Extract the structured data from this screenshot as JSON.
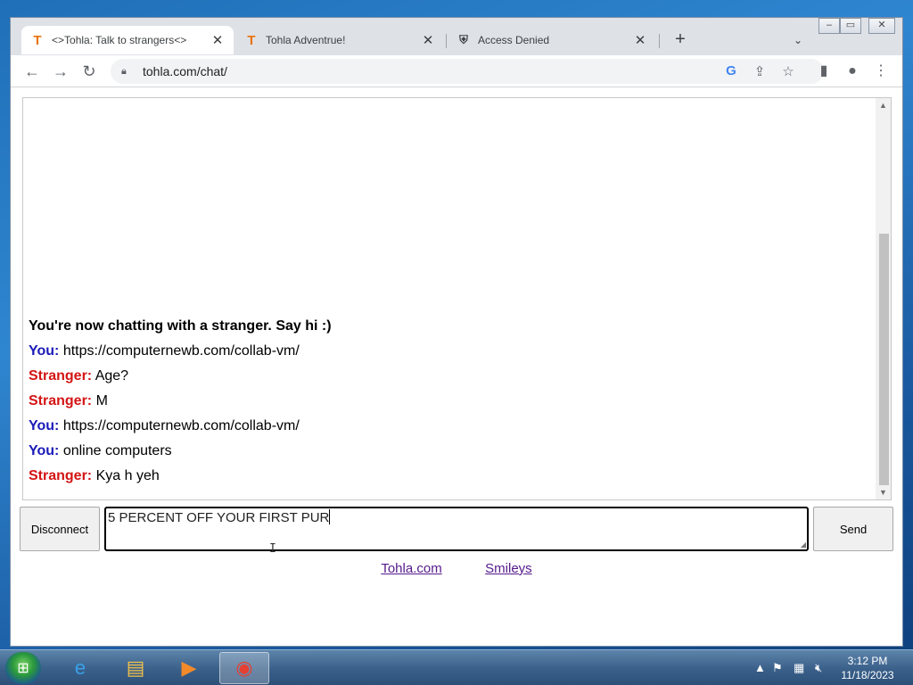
{
  "browser": {
    "tabs": [
      {
        "title": "<>Tohla: Talk to strangers<>",
        "favicon": "tohla-favicon",
        "active": true
      },
      {
        "title": "Tohla Adventrue!",
        "favicon": "tohla-favicon",
        "active": false
      },
      {
        "title": "Access Denied",
        "favicon": "shield-favicon",
        "active": false
      }
    ],
    "favicon_letter": "T",
    "url": "tohla.com/chat/",
    "google_letter": "G"
  },
  "chat": {
    "system_message": "You're now chatting with a stranger. Say hi :)",
    "messages": [
      {
        "sender": "You:",
        "text": "https://computernewb.com/collab-vm/",
        "role": "you"
      },
      {
        "sender": "Stranger:",
        "text": "Age?",
        "role": "stranger"
      },
      {
        "sender": "Stranger:",
        "text": "M",
        "role": "stranger"
      },
      {
        "sender": "You:",
        "text": "https://computernewb.com/collab-vm/",
        "role": "you"
      },
      {
        "sender": "You:",
        "text": "online computers",
        "role": "you"
      },
      {
        "sender": "Stranger:",
        "text": "Kya h yeh",
        "role": "stranger"
      }
    ],
    "disconnect_label": "Disconnect",
    "input_value": "5 PERCENT OFF YOUR FIRST PUR",
    "send_label": "Send",
    "links": [
      "Tohla.com",
      "Smileys"
    ]
  },
  "colors": {
    "you": "#1a1ab8",
    "stranger": "#d41414",
    "link": "#551a8b"
  },
  "taskbar": {
    "items": [
      "internet-explorer-icon",
      "file-explorer-icon",
      "media-player-icon",
      "chrome-icon"
    ],
    "time": "3:12 PM",
    "date": "11/18/2023"
  }
}
